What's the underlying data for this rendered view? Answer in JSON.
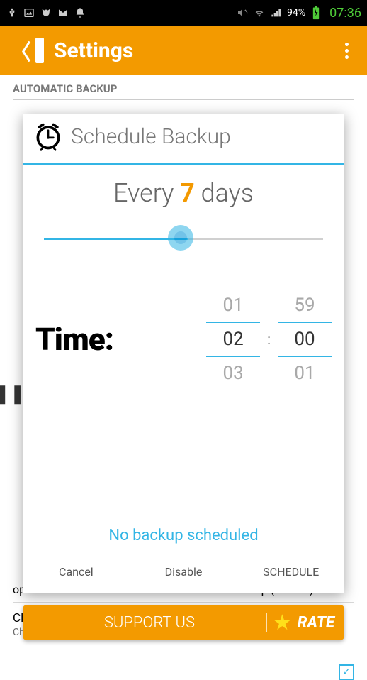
{
  "status_bar": {
    "battery_pct": "94%",
    "time": "07:36"
  },
  "action_bar": {
    "title": "Settings"
  },
  "bg": {
    "section_header": "AUTOMATIC BACKUP",
    "upload_desc_part": "option doesn't work with CWM Incremental backup (default).",
    "cloud_title": "Cloud network",
    "cloud_desc": "Choose and configure Cloud network."
  },
  "dialog": {
    "title": "Schedule Backup",
    "every_prefix": "Every ",
    "every_value": "7",
    "every_suffix": " days",
    "time_label": "Time:",
    "hours": {
      "above": "01",
      "selected": "02",
      "below": "03"
    },
    "minutes": {
      "above": "59",
      "selected": "00",
      "below": "01"
    },
    "status_text": "No backup scheduled",
    "btn_cancel": "Cancel",
    "btn_disable": "Disable",
    "btn_schedule": "SCHEDULE"
  },
  "banner": {
    "support": "SUPPORT US",
    "rate": "RATE"
  },
  "colors": {
    "accent": "#f39a00",
    "blue": "#33b5e5"
  }
}
